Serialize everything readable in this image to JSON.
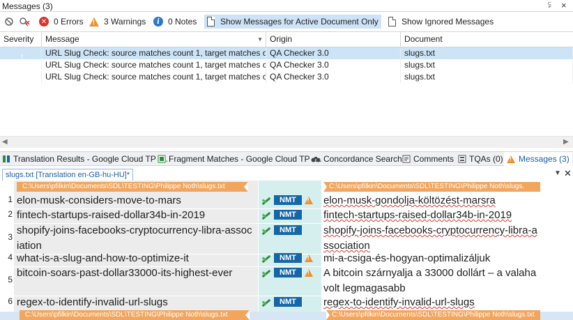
{
  "messages_panel": {
    "title": "Messages (3)",
    "pin_glyph": "⫋",
    "close_glyph": "×",
    "toolbar": {
      "errors_label": "0 Errors",
      "warnings_label": "3 Warnings",
      "notes_label": "0 Notes",
      "active_doc_label": "Show Messages for Active Document Only",
      "ignored_label": "Show Ignored Messages"
    },
    "columns": [
      "Severity",
      "Message",
      "Origin",
      "Document"
    ],
    "rows": [
      {
        "severity": "warning",
        "message": "URL Slug Check: source matches count 1, target matches c...",
        "origin": "QA Checker 3.0",
        "document": "slugs.txt"
      },
      {
        "severity": "warning",
        "message": "URL Slug Check: source matches count 1, target matches c...",
        "origin": "QA Checker 3.0",
        "document": "slugs.txt"
      },
      {
        "severity": "warning",
        "message": "URL Slug Check: source matches count 1, target matches c...",
        "origin": "QA Checker 3.0",
        "document": "slugs.txt"
      }
    ]
  },
  "tabs": [
    {
      "label": "Translation Results - Google Cloud TP -..."
    },
    {
      "label": "Fragment Matches - Google Cloud TP -..."
    },
    {
      "label": "Concordance Search"
    },
    {
      "label": "Comments"
    },
    {
      "label": "TQAs (0)"
    },
    {
      "label": "Messages (3)"
    }
  ],
  "editor": {
    "doc_tab": "slugs.txt [Translation en-GB-hu-HU]*",
    "file_tag_src": "C:\\Users\\pfilkin\\Documents\\SDL\\TESTING\\Philippe Noth\\slugs.txt",
    "file_tag_tgt": "C:\\Users\\pfilkin\\Documents\\SDL\\TESTING\\Philippe Noth\\slugs.",
    "file_tag_src_bottom": "C:\\Users\\pfilkin\\Documents\\SDL\\TESTING\\Philippe Noth\\slugs.txt",
    "file_tag_tgt_bottom": "C:\\Users\\pfilkin\\Documents\\SDL\\TESTING\\Philippe Noth\\slugs.txt",
    "match_label": "NMT",
    "segments": [
      {
        "num": "1",
        "source": "elon-musk-considers-move-to-mars",
        "target": "elon-musk-gondolja-költözést-marsra",
        "warning": true
      },
      {
        "num": "2",
        "source": "fintech-startups-raised-dollar34b-in-2019",
        "target": "fintech-startups-raised-dollar34b-in-2019",
        "warning": false
      },
      {
        "num": "3",
        "source": "shopify-joins-facebooks-cryptocurrency-libra-association",
        "target": "shopify-joins-facebooks-cryptocurrency-libra-association",
        "warning": false
      },
      {
        "num": "4",
        "source": "what-is-a-slug-and-how-to-optimize-it",
        "target": "mi-a-csiga-és-hogyan-optimalizáljuk",
        "warning": true
      },
      {
        "num": "5",
        "source": "bitcoin-soars-past-dollar33000-its-highest-ever",
        "target": "A bitcoin szárnyalja a 33000 dollárt – a valaha volt legmagasabb",
        "warning": true
      },
      {
        "num": "6",
        "source": "regex-to-identify-invalid-url-slugs",
        "target": "regex-to-identify-invalid-url-slugs",
        "warning": false
      }
    ]
  },
  "colors": {
    "accent": "#1c5fa7",
    "warning": "#f0902b",
    "error": "#d9352a",
    "nmt": "#1565a7",
    "tag": "#f2a55c"
  }
}
